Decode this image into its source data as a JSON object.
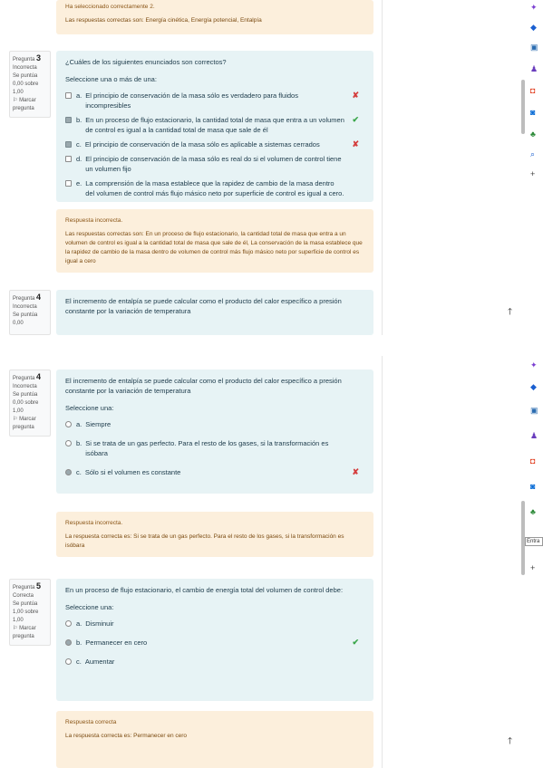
{
  "top": {
    "prev_feedback": {
      "line1": "Ha seleccionado correctamente 2.",
      "line2": "Las respuestas correctas son: Energía cinética, Energía potencial, Entalpía"
    },
    "q3": {
      "info": {
        "pregunta": "Pregunta",
        "number": "3",
        "status": "Incorrecta",
        "score": "Se puntúa 0,00 sobre 1,00",
        "flag": "Marcar pregunta"
      },
      "prompt": "¿Cuáles de los siguientes enunciados son correctos?",
      "select_label": "Seleccione una o más de una:",
      "answers": [
        {
          "letter": "a.",
          "text": "El principio de conservación de la masa sólo es verdadero para fluidos incompresibles",
          "mark": "✘"
        },
        {
          "letter": "b.",
          "text": "En un proceso de flujo estacionario, la cantidad total de masa que entra a un volumen de control es igual a la cantidad total de masa que sale de él",
          "mark": "✔"
        },
        {
          "letter": "c.",
          "text": "El principio de conservación de la masa sólo es aplicable a sistemas cerrados",
          "mark": "✘"
        },
        {
          "letter": "d.",
          "text": "El principio de conservación de la masa sólo es real do si el volumen de control tiene un volumen fijo",
          "mark": ""
        },
        {
          "letter": "e.",
          "text": "La comprensión de la masa establece que la rapidez de cambio de la masa dentro del volumen de control más flujo másico neto por superficie de control es igual a cero.",
          "mark": ""
        }
      ],
      "feedback": {
        "title": "Respuesta incorrecta.",
        "text": "Las respuestas correctas son: En un proceso de flujo estacionario, la cantidad total de masa que entra a un volumen de control es igual a la cantidad total de masa que sale de él, La conservación de la masa establece que la rapidez de cambio de la masa dentro de volumen de control más flujo másico neto por superficie de control es igual a cero"
      }
    },
    "q4_partial": {
      "info": {
        "pregunta": "Pregunta",
        "number": "4",
        "status": "Incorrecta",
        "score": "Se puntúa 0,00"
      },
      "prompt": "El incremento de entalpía se puede calcular como el producto del calor específico a presión constante por la variación de temperatura"
    }
  },
  "bottom": {
    "q4": {
      "info": {
        "pregunta": "Pregunta",
        "number": "4",
        "status": "Incorrecta",
        "score": "Se puntúa 0,00 sobre 1,00",
        "flag": "Marcar pregunta"
      },
      "prompt": "El incremento de entalpía se puede calcular como el producto del calor específico a presión constante por la variación de temperatura",
      "select_label": "Seleccione una:",
      "answers": [
        {
          "letter": "a.",
          "text": "Siempre",
          "mark": ""
        },
        {
          "letter": "b.",
          "text": "Si se trata de un gas perfecto. Para el resto de los gases, si la transformación es isóbara",
          "mark": ""
        },
        {
          "letter": "c.",
          "text": "Sólo si el volumen es constante",
          "mark": "✘"
        }
      ],
      "feedback": {
        "title": "Respuesta incorrecta.",
        "text": "La respuesta correcta es: Si se trata de un gas perfecto. Para el resto de los gases, si la transformación es isóbara"
      }
    },
    "q5": {
      "info": {
        "pregunta": "Pregunta",
        "number": "5",
        "status": "Correcta",
        "score": "Se puntúa 1,00 sobre 1,00",
        "flag": "Marcar pregunta"
      },
      "prompt": "En un proceso de flujo estacionario, el cambio de energía total del volumen de control debe:",
      "select_label": "Seleccione una:",
      "answers": [
        {
          "letter": "a.",
          "text": "Disminuir",
          "mark": ""
        },
        {
          "letter": "b.",
          "text": "Permanecer en cero",
          "mark": "✔"
        },
        {
          "letter": "c.",
          "text": "Aumentar",
          "mark": ""
        }
      ],
      "feedback": {
        "title": "Respuesta correcta",
        "text": "La respuesta correcta es: Permanecer en cero"
      }
    },
    "entra_label": "Entra"
  },
  "icons": {
    "rail": [
      "star-icon",
      "diamond-icon",
      "briefcase-icon",
      "person-icon",
      "office-icon",
      "outlook-icon",
      "tree-icon",
      "search-icon",
      "add-icon"
    ],
    "colors": {
      "star": "#7b3fd1",
      "diamond": "#1a5fd0",
      "briefcase": "#2b6cb0",
      "person": "#6a3dbd",
      "office": "#e03b1c",
      "outlook": "#0a6cd6",
      "tree": "#2e8b3a",
      "search": "#1a5fd0"
    }
  }
}
